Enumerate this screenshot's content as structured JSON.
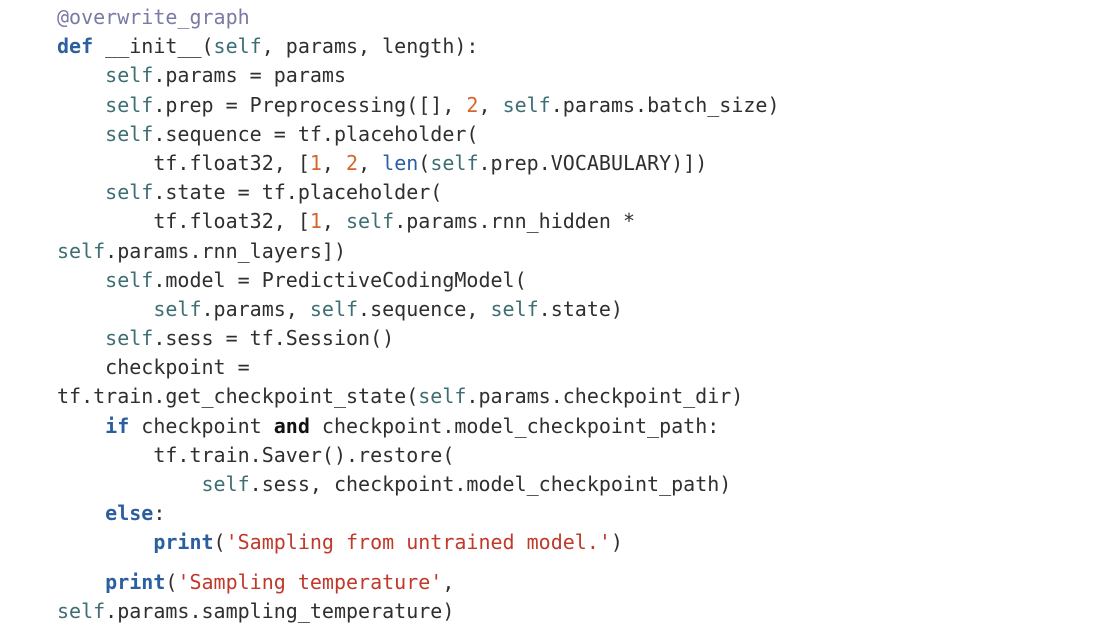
{
  "code": {
    "lines": [
      {
        "indent": 0,
        "tokens": [
          {
            "t": "decorator",
            "v": "@overwrite_graph"
          }
        ]
      },
      {
        "indent": 0,
        "tokens": [
          {
            "t": "keyword",
            "v": "def"
          },
          {
            "t": "plain",
            "v": " __init__("
          },
          {
            "t": "self",
            "v": "self"
          },
          {
            "t": "plain",
            "v": ", params, length):"
          }
        ]
      },
      {
        "indent": 4,
        "tokens": [
          {
            "t": "self",
            "v": "self"
          },
          {
            "t": "plain",
            "v": ".params = params"
          }
        ]
      },
      {
        "indent": 4,
        "tokens": [
          {
            "t": "self",
            "v": "self"
          },
          {
            "t": "plain",
            "v": ".prep = Preprocessing([], "
          },
          {
            "t": "number",
            "v": "2"
          },
          {
            "t": "plain",
            "v": ", "
          },
          {
            "t": "self",
            "v": "self"
          },
          {
            "t": "plain",
            "v": ".params.batch_size)"
          }
        ]
      },
      {
        "indent": 4,
        "tokens": [
          {
            "t": "self",
            "v": "self"
          },
          {
            "t": "plain",
            "v": ".sequence = tf.placeholder("
          }
        ]
      },
      {
        "indent": 8,
        "tokens": [
          {
            "t": "plain",
            "v": "tf.float32, ["
          },
          {
            "t": "number",
            "v": "1"
          },
          {
            "t": "plain",
            "v": ", "
          },
          {
            "t": "number",
            "v": "2"
          },
          {
            "t": "plain",
            "v": ", "
          },
          {
            "t": "builtin",
            "v": "len"
          },
          {
            "t": "plain",
            "v": "("
          },
          {
            "t": "self",
            "v": "self"
          },
          {
            "t": "plain",
            "v": ".prep.VOCABULARY)])"
          }
        ]
      },
      {
        "indent": 4,
        "tokens": [
          {
            "t": "self",
            "v": "self"
          },
          {
            "t": "plain",
            "v": ".state = tf.placeholder("
          }
        ]
      },
      {
        "indent": 8,
        "tokens": [
          {
            "t": "plain",
            "v": "tf.float32, ["
          },
          {
            "t": "number",
            "v": "1"
          },
          {
            "t": "plain",
            "v": ", "
          },
          {
            "t": "self",
            "v": "self"
          },
          {
            "t": "plain",
            "v": ".params.rnn_hidden *"
          }
        ]
      },
      {
        "indent": 0,
        "tokens": [
          {
            "t": "self",
            "v": "self"
          },
          {
            "t": "plain",
            "v": ".params.rnn_layers])"
          }
        ]
      },
      {
        "indent": 4,
        "tokens": [
          {
            "t": "self",
            "v": "self"
          },
          {
            "t": "plain",
            "v": ".model = PredictiveCodingModel("
          }
        ]
      },
      {
        "indent": 8,
        "tokens": [
          {
            "t": "self",
            "v": "self"
          },
          {
            "t": "plain",
            "v": ".params, "
          },
          {
            "t": "self",
            "v": "self"
          },
          {
            "t": "plain",
            "v": ".sequence, "
          },
          {
            "t": "self",
            "v": "self"
          },
          {
            "t": "plain",
            "v": ".state)"
          }
        ]
      },
      {
        "indent": 4,
        "tokens": [
          {
            "t": "self",
            "v": "self"
          },
          {
            "t": "plain",
            "v": ".sess = tf.Session()"
          }
        ]
      },
      {
        "indent": 4,
        "tokens": [
          {
            "t": "plain",
            "v": "checkpoint ="
          }
        ]
      },
      {
        "indent": 0,
        "tokens": [
          {
            "t": "plain",
            "v": "tf.train.get_checkpoint_state("
          },
          {
            "t": "self",
            "v": "self"
          },
          {
            "t": "plain",
            "v": ".params.checkpoint_dir)"
          }
        ]
      },
      {
        "indent": 4,
        "tokens": [
          {
            "t": "keyword",
            "v": "if"
          },
          {
            "t": "plain",
            "v": " checkpoint "
          },
          {
            "t": "kwbold",
            "v": "and"
          },
          {
            "t": "plain",
            "v": " checkpoint.model_checkpoint_path:"
          }
        ]
      },
      {
        "indent": 8,
        "tokens": [
          {
            "t": "plain",
            "v": "tf.train.Saver().restore("
          }
        ]
      },
      {
        "indent": 12,
        "tokens": [
          {
            "t": "self",
            "v": "self"
          },
          {
            "t": "plain",
            "v": ".sess, checkpoint.model_checkpoint_path)"
          }
        ]
      },
      {
        "indent": 4,
        "tokens": [
          {
            "t": "keyword",
            "v": "else"
          },
          {
            "t": "plain",
            "v": ":"
          }
        ]
      },
      {
        "indent": 8,
        "tokens": [
          {
            "t": "keyword",
            "v": "print"
          },
          {
            "t": "plain",
            "v": "("
          },
          {
            "t": "string",
            "v": "'Sampling from untrained model.'"
          },
          {
            "t": "plain",
            "v": ")"
          }
        ]
      },
      {
        "indent": 4,
        "gap_before": true,
        "tokens": [
          {
            "t": "keyword",
            "v": "print"
          },
          {
            "t": "plain",
            "v": "("
          },
          {
            "t": "string",
            "v": "'Sampling temperature'"
          },
          {
            "t": "plain",
            "v": ","
          }
        ]
      },
      {
        "indent": 0,
        "tokens": [
          {
            "t": "self",
            "v": "self"
          },
          {
            "t": "plain",
            "v": ".params.sampling_temperature)"
          }
        ]
      }
    ]
  }
}
